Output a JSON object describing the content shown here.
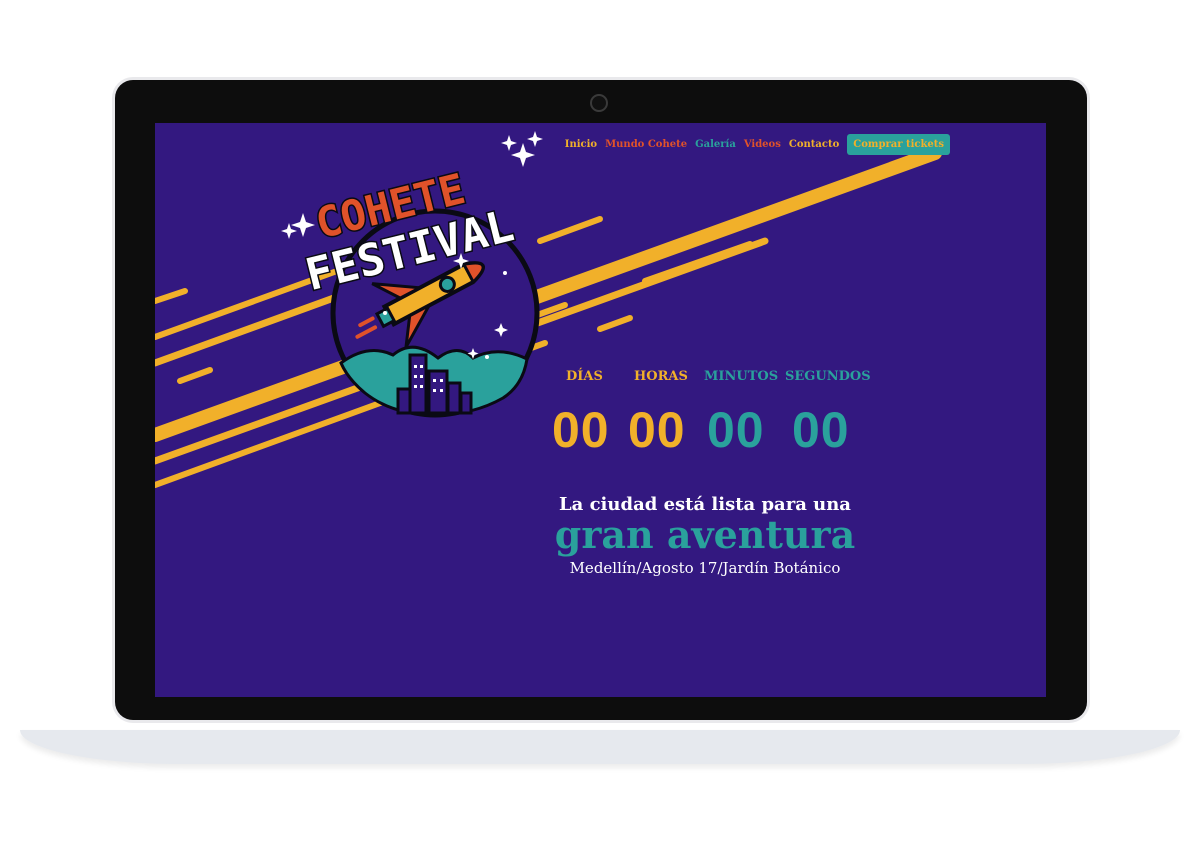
{
  "nav": {
    "items": [
      {
        "label": "Inicio",
        "color": "#f1b02a"
      },
      {
        "label": "Mundo Cohete",
        "color": "#e0522a"
      },
      {
        "label": "Galería",
        "color": "#2aa19c"
      },
      {
        "label": "Videos",
        "color": "#e0522a"
      },
      {
        "label": "Contacto",
        "color": "#f1b02a"
      }
    ],
    "cta": "Comprar tickets"
  },
  "logo": {
    "line1": "COHETE",
    "line2": "FESTIVAL"
  },
  "countdown": {
    "labels": {
      "days": "DÍAS",
      "hours": "HORAS",
      "minutes": "MINUTOS",
      "seconds": "SEGUNDOS"
    },
    "values": {
      "days": "00",
      "hours": "00",
      "minutes": "00",
      "seconds": "00"
    }
  },
  "hero": {
    "line1": "La ciudad está lista para una",
    "line2": "gran aventura",
    "line3": "Medellín/Agosto 17/Jardín Botánico"
  },
  "colors": {
    "background": "#331880",
    "yellow": "#f1b02a",
    "teal": "#2aa19c",
    "red": "#e0522a"
  }
}
